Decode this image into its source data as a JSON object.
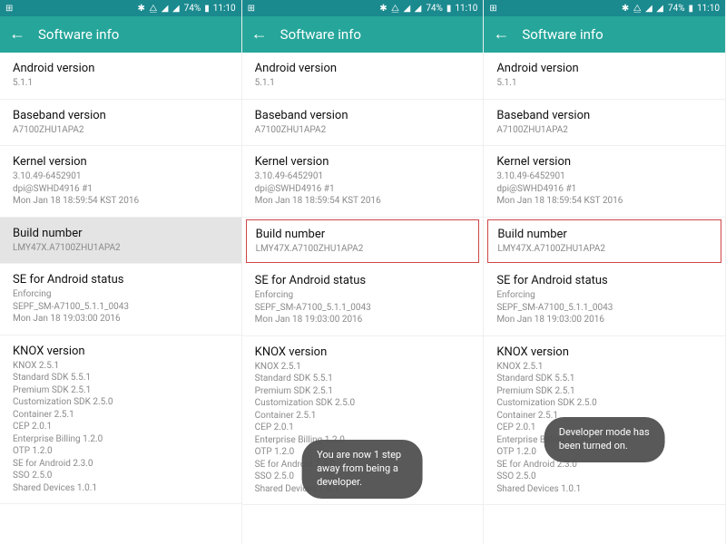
{
  "status": {
    "left_icon": "⊞",
    "icons": "✱ ⧋ ◢ ◢",
    "battery_text": "74%",
    "battery_icon": "▮",
    "time": "11:10"
  },
  "header": {
    "back_glyph": "←",
    "title": "Software info"
  },
  "rows": {
    "android": {
      "label": "Android version",
      "sub": "5.1.1"
    },
    "baseband": {
      "label": "Baseband version",
      "sub": "A7100ZHU1APA2"
    },
    "kernel": {
      "label": "Kernel version",
      "sub1": "3.10.49-6452901",
      "sub2": "dpi@SWHD4916 #1",
      "sub3": "Mon Jan 18 18:59:54 KST 2016"
    },
    "build": {
      "label": "Build number",
      "sub": "LMY47X.A7100ZHU1APA2"
    },
    "se": {
      "label": "SE for Android status",
      "sub1": "Enforcing",
      "sub2": "SEPF_SM-A7100_5.1.1_0043",
      "sub3": "Mon Jan 18 19:03:00 2016"
    },
    "knox": {
      "label": "KNOX version",
      "sub1": "KNOX 2.5.1",
      "sub2": "Standard SDK 5.5.1",
      "sub3": "Premium SDK 2.5.1",
      "sub4": "Customization SDK 2.5.0",
      "sub5": "Container 2.5.1",
      "sub6": "CEP 2.0.1",
      "sub7": "Enterprise Billing 1.2.0",
      "sub8": "OTP 1.2.0",
      "sub9": "SE for Android 2.3.0",
      "sub10": "SSO 2.5.0",
      "sub11": "Shared Devices 1.0.1"
    }
  },
  "toasts": {
    "step": "You are now 1 step away from being a developer.",
    "done": "Developer mode has been turned on."
  }
}
